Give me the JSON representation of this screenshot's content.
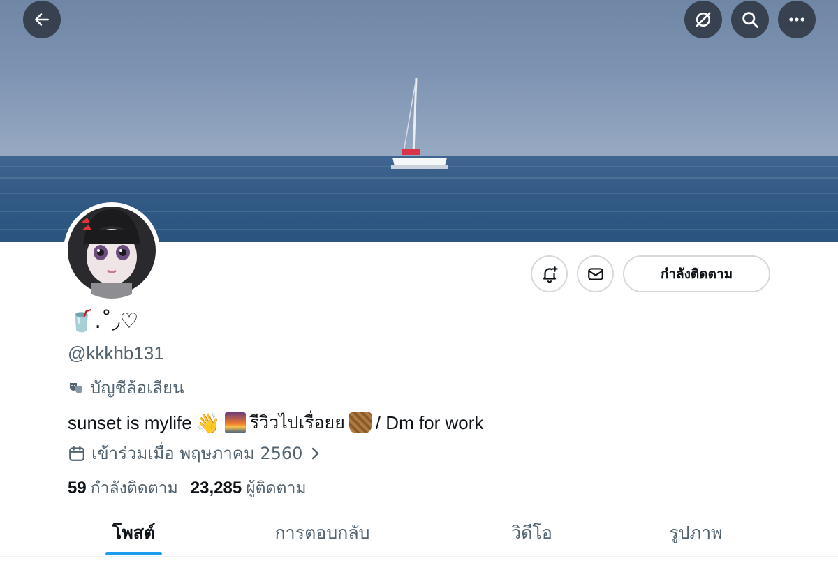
{
  "header": {
    "back_icon": "arrow-left-icon",
    "actions": [
      "link-off-icon",
      "search-icon",
      "more-icon"
    ]
  },
  "banner": {
    "accent_sky": "#7d93b2",
    "accent_sea": "#2f5886"
  },
  "profile": {
    "display_name": "🥤.˚◞♡",
    "handle": "@kkkhb131",
    "parody_label": "บัญชีล้อเลียน",
    "bio": {
      "text_1": "sunset is mylife",
      "text_2": "รีวิวไปเรื่อยย",
      "text_3": "/ Dm for work"
    },
    "joined": "เข้าร่วมเมื่อ พฤษภาคม 2560",
    "following_count": "59",
    "following_label": "กำลังติดตาม",
    "followers_count": "23,285",
    "followers_label": "ผู้ติดตาม"
  },
  "actions": {
    "notify_icon": "bell-plus-icon",
    "message_icon": "mail-icon",
    "follow_label": "กำลังติดตาม"
  },
  "tabs": [
    {
      "label": "โพสต์",
      "active": true
    },
    {
      "label": "การตอบกลับ",
      "active": false
    },
    {
      "label": "วิดีโอ",
      "active": false
    },
    {
      "label": "รูปภาพ",
      "active": false
    }
  ],
  "colors": {
    "accent": "#1d9bf0",
    "secondary_text": "#536471",
    "primary_text": "#0f1419"
  }
}
